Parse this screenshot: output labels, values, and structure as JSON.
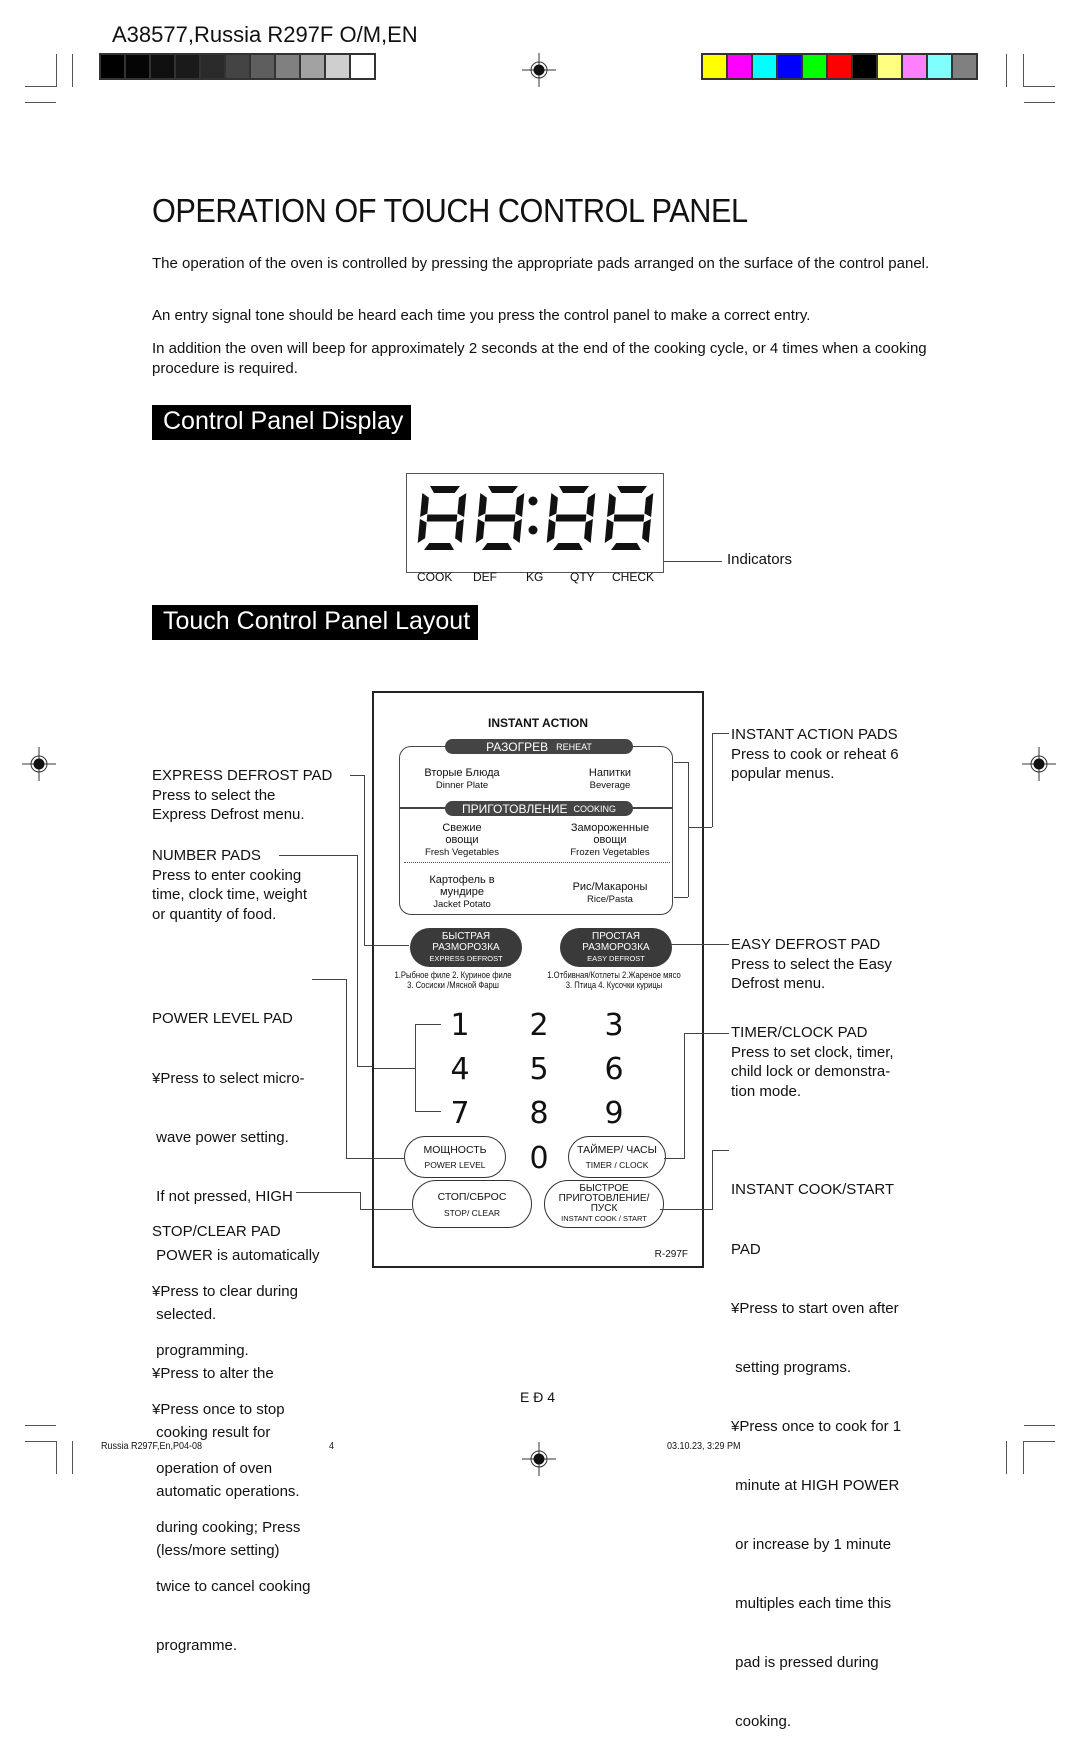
{
  "print_marks": {
    "job_title": "A38577,Russia R297F O/M,EN",
    "gray_swatches": [
      "#000000",
      "#050505",
      "#0f0f0f",
      "#1a1a1a",
      "#2a2a2a",
      "#444444",
      "#5e5e5e",
      "#808080",
      "#a2a2a2",
      "#cfcfcf",
      "#ffffff"
    ],
    "color_swatches": [
      "#ffff00",
      "#ff00ff",
      "#00ffff",
      "#0000ff",
      "#00ff00",
      "#ff0000",
      "#000000",
      "#ffff80",
      "#ff80ff",
      "#80ffff",
      "#808080"
    ]
  },
  "page": {
    "title": "OPERATION OF TOUCH CONTROL PANEL",
    "paragraphs": [
      "The operation of the oven is controlled by pressing the appropriate pads arranged on the surface of the control panel.",
      "An entry signal tone should be heard each time you press the control panel to make a correct entry.",
      "In addition the oven will beep for approximately 2 seconds at the end of the cooking cycle, or 4 times when a cooking procedure is required."
    ],
    "section_display": "Control Panel Display",
    "section_layout": "Touch  Control Panel Layout"
  },
  "display": {
    "digits": "88:88",
    "indicators": [
      "COOK",
      "DEF",
      "KG",
      "QTY",
      "CHECK"
    ],
    "callout": "Indicators"
  },
  "panel": {
    "instant_action_title": "INSTANT ACTION",
    "reheat_ru": "РАЗОГРЕВ",
    "reheat_en": "REHEAT",
    "cooking_ru": "ПРИГОТОВЛЕНИЕ",
    "cooking_en": "COOKING",
    "menus": [
      {
        "ru": "Вторые Блюда",
        "en": "Dinner Plate"
      },
      {
        "ru": "Напитки",
        "en": "Beverage"
      },
      {
        "ru": "Свежие овощи",
        "en": "Fresh Vegetables"
      },
      {
        "ru": "Замороженные овощи",
        "en": "Frozen Vegetables"
      },
      {
        "ru": "Картофель в мундире",
        "en": "Jacket Potato"
      },
      {
        "ru": "Рис/Макароны",
        "en": "Rice/Pasta"
      }
    ],
    "express_defrost": {
      "ru1": "БЫСТРАЯ",
      "ru2": "РАЗМОРОЗКА",
      "en": "EXPRESS DEFROST",
      "options1": "1.Рыбное филе 2. Куриное филе",
      "options2": "3. Сосиски /Мясной Фарш"
    },
    "easy_defrost": {
      "ru1": "ПРОСТАЯ",
      "ru2": "РАЗМОРОЗКА",
      "en": "EASY DEFROST",
      "options1": "1.Отбивная/Котлеты  2.Жареное мясо",
      "options2": "3. Птица   4. Кусочки курицы"
    },
    "digits": [
      "1",
      "2",
      "3",
      "4",
      "5",
      "6",
      "7",
      "8",
      "9",
      "0"
    ],
    "power_level": {
      "ru": "МОЩНОСТЬ",
      "en": "POWER LEVEL"
    },
    "timer_clock": {
      "ru": "ТАЙМЕР/ ЧАСЫ",
      "en": "TIMER / CLOCK"
    },
    "stop_clear": {
      "ru": "СТОП/СБРОС",
      "en": "STOP/ CLEAR"
    },
    "instant_start": {
      "ru1": "БЫСТРОЕ",
      "ru2": "ПРИГОТОВЛЕНИЕ/",
      "ru3": "ПУСК",
      "en": "INSTANT COOK / START"
    },
    "model": "R-297F"
  },
  "callouts": {
    "express_defrost": {
      "head": "EXPRESS DEFROST PAD",
      "lines": [
        "Press to select the",
        "Express Defrost menu."
      ]
    },
    "number_pads": {
      "head": "NUMBER PADS",
      "lines": [
        "Press to enter cooking",
        "time, clock time, weight",
        "or quantity of food."
      ]
    },
    "power_level": {
      "head": "POWER LEVEL PAD",
      "lines": [
        "¥Press to select micro-",
        " wave power setting.",
        " If not pressed, HIGH",
        " POWER is automatically",
        " selected.",
        "¥Press to alter the",
        " cooking result for",
        " automatic operations.",
        " (less/more setting)"
      ]
    },
    "stop_clear": {
      "head": "STOP/CLEAR PAD",
      "lines": [
        "¥Press to clear during",
        " programming.",
        "¥Press once to stop",
        " operation of oven",
        " during cooking; Press",
        " twice to cancel cooking",
        " programme."
      ]
    },
    "instant_action": {
      "head": "INSTANT ACTION PADS",
      "lines": [
        "Press to cook or reheat 6",
        "popular menus."
      ]
    },
    "easy_defrost": {
      "head": "EASY DEFROST PAD",
      "lines": [
        "Press to select the Easy",
        "Defrost menu."
      ]
    },
    "timer_clock": {
      "head": "TIMER/CLOCK PAD",
      "lines": [
        "Press to set clock, timer,",
        "child lock or demonstra-",
        "tion mode."
      ]
    },
    "instant_start": {
      "head": "INSTANT COOK/START",
      "head2": "PAD",
      "lines": [
        "¥Press to start oven after",
        " setting programs.",
        "¥Press once to cook for 1",
        " minute at HIGH POWER",
        " or increase by 1 minute",
        " multiples each time this",
        " pad is pressed during",
        " cooking."
      ]
    }
  },
  "footer": {
    "page_label": "E Ð 4",
    "file": "Russia R297F,En,P04-08",
    "page_num": "4",
    "timestamp": "03.10.23, 3:29 PM"
  }
}
